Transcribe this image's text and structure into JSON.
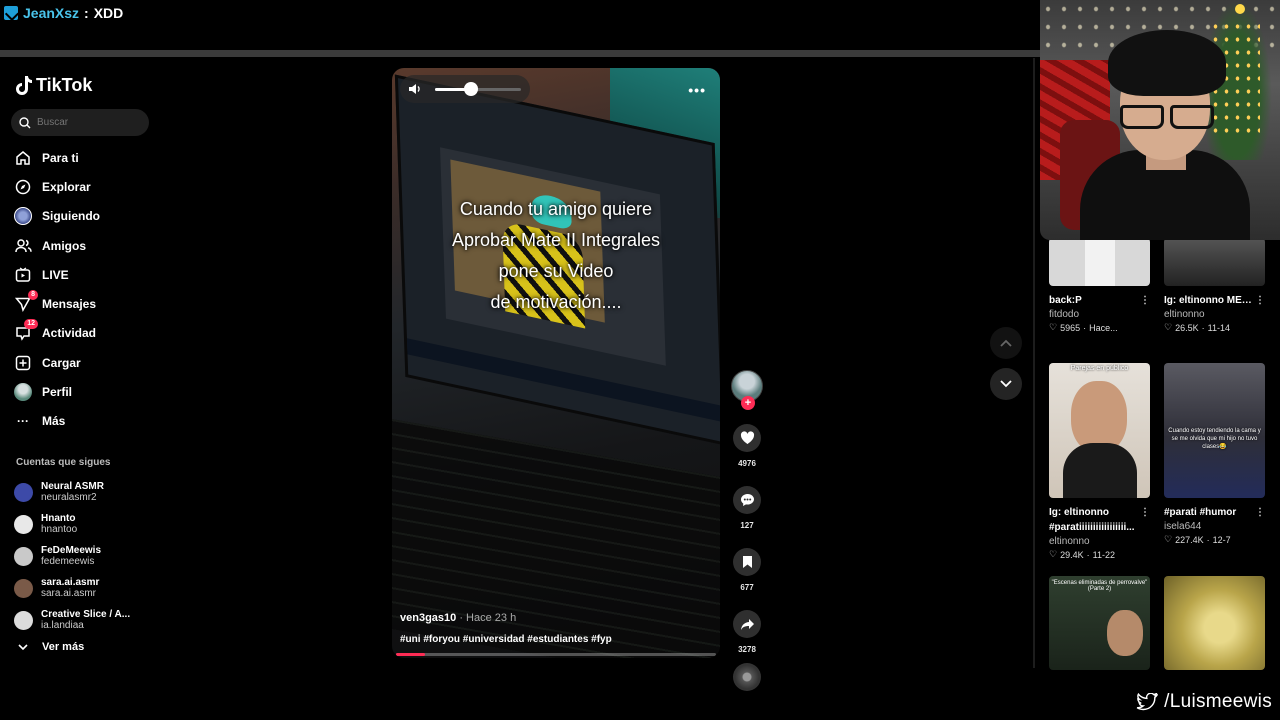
{
  "overlay": {
    "chat_user": "JeanXsz",
    "chat_separator": " : ",
    "chat_message": "XDD",
    "twitter_handle": "/Luismeewis"
  },
  "sidebar": {
    "logo": "TikTok",
    "search_placeholder": "Buscar",
    "nav": [
      {
        "label": "Para ti",
        "icon": "home-icon"
      },
      {
        "label": "Explorar",
        "icon": "compass-icon"
      },
      {
        "label": "Siguiendo",
        "icon": "following-avatar-icon"
      },
      {
        "label": "Amigos",
        "icon": "friends-icon"
      },
      {
        "label": "LIVE",
        "icon": "live-tv-icon"
      },
      {
        "label": "Mensajes",
        "icon": "send-icon",
        "badge": "8"
      },
      {
        "label": "Actividad",
        "icon": "inbox-icon",
        "badge": "12"
      },
      {
        "label": "Cargar",
        "icon": "plus-square-icon"
      },
      {
        "label": "Perfil",
        "icon": "profile-avatar-icon"
      },
      {
        "label": "Más",
        "icon": "more-icon"
      }
    ],
    "following_title": "Cuentas que sigues",
    "following": [
      {
        "name": "Neural ASMR",
        "handle": "neuralasmr2",
        "color": "#3d4aa8"
      },
      {
        "name": "Hnanto",
        "handle": "hnantoo",
        "color": "#e8e8e8"
      },
      {
        "name": "FeDeMeewis",
        "handle": "fedemeewis",
        "color": "#c9c9c9"
      },
      {
        "name": "sara.ai.asmr",
        "handle": "sara.ai.asmr",
        "color": "#7a5a48"
      },
      {
        "name": "Creative Slice / A...",
        "handle": "ia.landiaa",
        "color": "#dcdcdc"
      }
    ],
    "see_more": "Ver más"
  },
  "video": {
    "caption_lines": [
      "Cuando tu amigo quiere",
      "Aprobar Mate II Integrales",
      "pone su  Video",
      "de motivación...."
    ],
    "username": "ven3gas10",
    "time": " · Hace 23 h",
    "hashtags": "#uni #foryou #universidad #estudiantes #fyp",
    "volume_level": 0.42,
    "progress": 0.09
  },
  "actions": {
    "likes": "4976",
    "comments": "127",
    "saves": "677",
    "shares": "3278"
  },
  "cards": [
    {
      "title": "back:P",
      "author": "fitdodo",
      "views": "5965",
      "date": "Hace...",
      "thumb": "#d8d8d8"
    },
    {
      "title": "Ig: eltinonno MELANCOLÍA...",
      "author": "eltinonno",
      "views": "26.5K",
      "date": "11-14",
      "thumb": "#3a3a3a"
    },
    {
      "title": "Ig: eltinonno #paratiiiiiiiiiiiiiiiii...",
      "author": "eltinonno",
      "views": "29.4K",
      "date": "11-22",
      "thumb": "#c8a58d",
      "overlay": "Parejas en público"
    },
    {
      "title": "#parati #humor",
      "author": "isela644",
      "views": "227.4K",
      "date": "12-7",
      "thumb": "#4a4a52",
      "overlay": "Cuando estoy tendiendo la cama y se me olvida que mi hijo no tuvo clases😂"
    },
    {
      "title": "",
      "author": "",
      "views": "",
      "date": "",
      "thumb": "#2a3a2a",
      "overlay": "\"Escenas eliminadas de perrovalve\" (Parte 2)"
    },
    {
      "title": "",
      "author": "",
      "views": "",
      "date": "",
      "thumb": "#b9a54a"
    }
  ],
  "colors": {
    "accent": "#fe2c55",
    "chat_user": "#49c3ea",
    "background": "#000000"
  }
}
